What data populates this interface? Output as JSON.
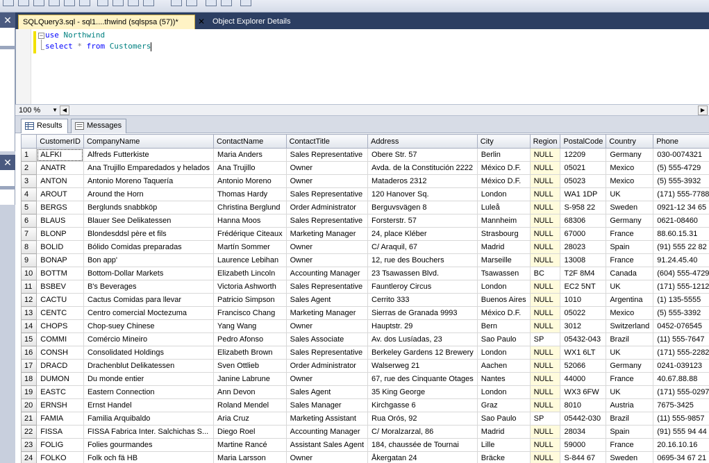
{
  "tabs": {
    "query_tab": "SQLQuery3.sql - sql1....thwind (sqlspsa (57))*",
    "other_tab": "Object Explorer Details"
  },
  "editor": {
    "line1": {
      "kw": "use",
      "ident": "Northwind"
    },
    "line2": {
      "kw1": "select",
      "op": "*",
      "kw2": "from",
      "ident": "Customers"
    }
  },
  "zoom": {
    "value": "100 %"
  },
  "results_tabs": {
    "results": "Results",
    "messages": "Messages"
  },
  "grid": {
    "columns": [
      "CustomerID",
      "CompanyName",
      "ContactName",
      "ContactTitle",
      "Address",
      "City",
      "Region",
      "PostalCode",
      "Country",
      "Phone"
    ],
    "rows": [
      [
        "1",
        "ALFKI",
        "Alfreds Futterkiste",
        "Maria Anders",
        "Sales Representative",
        "Obere Str. 57",
        "Berlin",
        "NULL",
        "12209",
        "Germany",
        "030-0074321"
      ],
      [
        "2",
        "ANATR",
        "Ana Trujillo Emparedados y helados",
        "Ana Trujillo",
        "Owner",
        "Avda. de la Constitución 2222",
        "México D.F.",
        "NULL",
        "05021",
        "Mexico",
        "(5) 555-4729"
      ],
      [
        "3",
        "ANTON",
        "Antonio Moreno Taquería",
        "Antonio Moreno",
        "Owner",
        "Mataderos  2312",
        "México D.F.",
        "NULL",
        "05023",
        "Mexico",
        "(5) 555-3932"
      ],
      [
        "4",
        "AROUT",
        "Around the Horn",
        "Thomas Hardy",
        "Sales Representative",
        "120 Hanover Sq.",
        "London",
        "NULL",
        "WA1 1DP",
        "UK",
        "(171) 555-7788"
      ],
      [
        "5",
        "BERGS",
        "Berglunds snabbköp",
        "Christina Berglund",
        "Order Administrator",
        "Berguvsvägen  8",
        "Luleå",
        "NULL",
        "S-958 22",
        "Sweden",
        "0921-12 34 65"
      ],
      [
        "6",
        "BLAUS",
        "Blauer See Delikatessen",
        "Hanna Moos",
        "Sales Representative",
        "Forsterstr. 57",
        "Mannheim",
        "NULL",
        "68306",
        "Germany",
        "0621-08460"
      ],
      [
        "7",
        "BLONP",
        "Blondesddsl père et fils",
        "Frédérique Citeaux",
        "Marketing Manager",
        "24, place Kléber",
        "Strasbourg",
        "NULL",
        "67000",
        "France",
        "88.60.15.31"
      ],
      [
        "8",
        "BOLID",
        "Bólido Comidas preparadas",
        "Martín Sommer",
        "Owner",
        "C/ Araquil, 67",
        "Madrid",
        "NULL",
        "28023",
        "Spain",
        "(91) 555 22 82"
      ],
      [
        "9",
        "BONAP",
        "Bon app'",
        "Laurence Lebihan",
        "Owner",
        "12, rue des Bouchers",
        "Marseille",
        "NULL",
        "13008",
        "France",
        "91.24.45.40"
      ],
      [
        "10",
        "BOTTM",
        "Bottom-Dollar Markets",
        "Elizabeth Lincoln",
        "Accounting Manager",
        "23 Tsawassen Blvd.",
        "Tsawassen",
        "BC",
        "T2F 8M4",
        "Canada",
        "(604) 555-4729"
      ],
      [
        "11",
        "BSBEV",
        "B's Beverages",
        "Victoria Ashworth",
        "Sales Representative",
        "Fauntleroy Circus",
        "London",
        "NULL",
        "EC2 5NT",
        "UK",
        "(171) 555-1212"
      ],
      [
        "12",
        "CACTU",
        "Cactus Comidas para llevar",
        "Patricio Simpson",
        "Sales Agent",
        "Cerrito 333",
        "Buenos Aires",
        "NULL",
        "1010",
        "Argentina",
        "(1) 135-5555"
      ],
      [
        "13",
        "CENTC",
        "Centro comercial Moctezuma",
        "Francisco Chang",
        "Marketing Manager",
        "Sierras de Granada 9993",
        "México D.F.",
        "NULL",
        "05022",
        "Mexico",
        "(5) 555-3392"
      ],
      [
        "14",
        "CHOPS",
        "Chop-suey Chinese",
        "Yang Wang",
        "Owner",
        "Hauptstr. 29",
        "Bern",
        "NULL",
        "3012",
        "Switzerland",
        "0452-076545"
      ],
      [
        "15",
        "COMMI",
        "Comércio Mineiro",
        "Pedro Afonso",
        "Sales Associate",
        "Av. dos Lusíadas, 23",
        "Sao Paulo",
        "SP",
        "05432-043",
        "Brazil",
        "(11) 555-7647"
      ],
      [
        "16",
        "CONSH",
        "Consolidated Holdings",
        "Elizabeth Brown",
        "Sales Representative",
        "Berkeley Gardens 12  Brewery",
        "London",
        "NULL",
        "WX1 6LT",
        "UK",
        "(171) 555-2282"
      ],
      [
        "17",
        "DRACD",
        "Drachenblut Delikatessen",
        "Sven Ottlieb",
        "Order Administrator",
        "Walserweg 21",
        "Aachen",
        "NULL",
        "52066",
        "Germany",
        "0241-039123"
      ],
      [
        "18",
        "DUMON",
        "Du monde entier",
        "Janine Labrune",
        "Owner",
        "67, rue des Cinquante Otages",
        "Nantes",
        "NULL",
        "44000",
        "France",
        "40.67.88.88"
      ],
      [
        "19",
        "EASTC",
        "Eastern Connection",
        "Ann Devon",
        "Sales Agent",
        "35 King George",
        "London",
        "NULL",
        "WX3 6FW",
        "UK",
        "(171) 555-0297"
      ],
      [
        "20",
        "ERNSH",
        "Ernst Handel",
        "Roland Mendel",
        "Sales Manager",
        "Kirchgasse 6",
        "Graz",
        "NULL",
        "8010",
        "Austria",
        "7675-3425"
      ],
      [
        "21",
        "FAMIA",
        "Familia Arquibaldo",
        "Aria Cruz",
        "Marketing Assistant",
        "Rua Orós, 92",
        "Sao Paulo",
        "SP",
        "05442-030",
        "Brazil",
        "(11) 555-9857"
      ],
      [
        "22",
        "FISSA",
        "FISSA Fabrica Inter. Salchichas S...",
        "Diego Roel",
        "Accounting Manager",
        "C/ Moralzarzal, 86",
        "Madrid",
        "NULL",
        "28034",
        "Spain",
        "(91) 555 94 44"
      ],
      [
        "23",
        "FOLIG",
        "Folies gourmandes",
        "Martine Rancé",
        "Assistant Sales Agent",
        "184, chaussée de Tournai",
        "Lille",
        "NULL",
        "59000",
        "France",
        "20.16.10.16"
      ],
      [
        "24",
        "FOLKO",
        "Folk och fä HB",
        "Maria Larsson",
        "Owner",
        "Åkergatan 24",
        "Bräcke",
        "NULL",
        "S-844 67",
        "Sweden",
        "0695-34 67 21"
      ]
    ]
  },
  "colors": {
    "null_bg": "#fffbdc",
    "active_tab": "#fff3c5",
    "tab_bar": "#2c3e62",
    "keyword": "#0000ff",
    "identifier": "#008080"
  }
}
